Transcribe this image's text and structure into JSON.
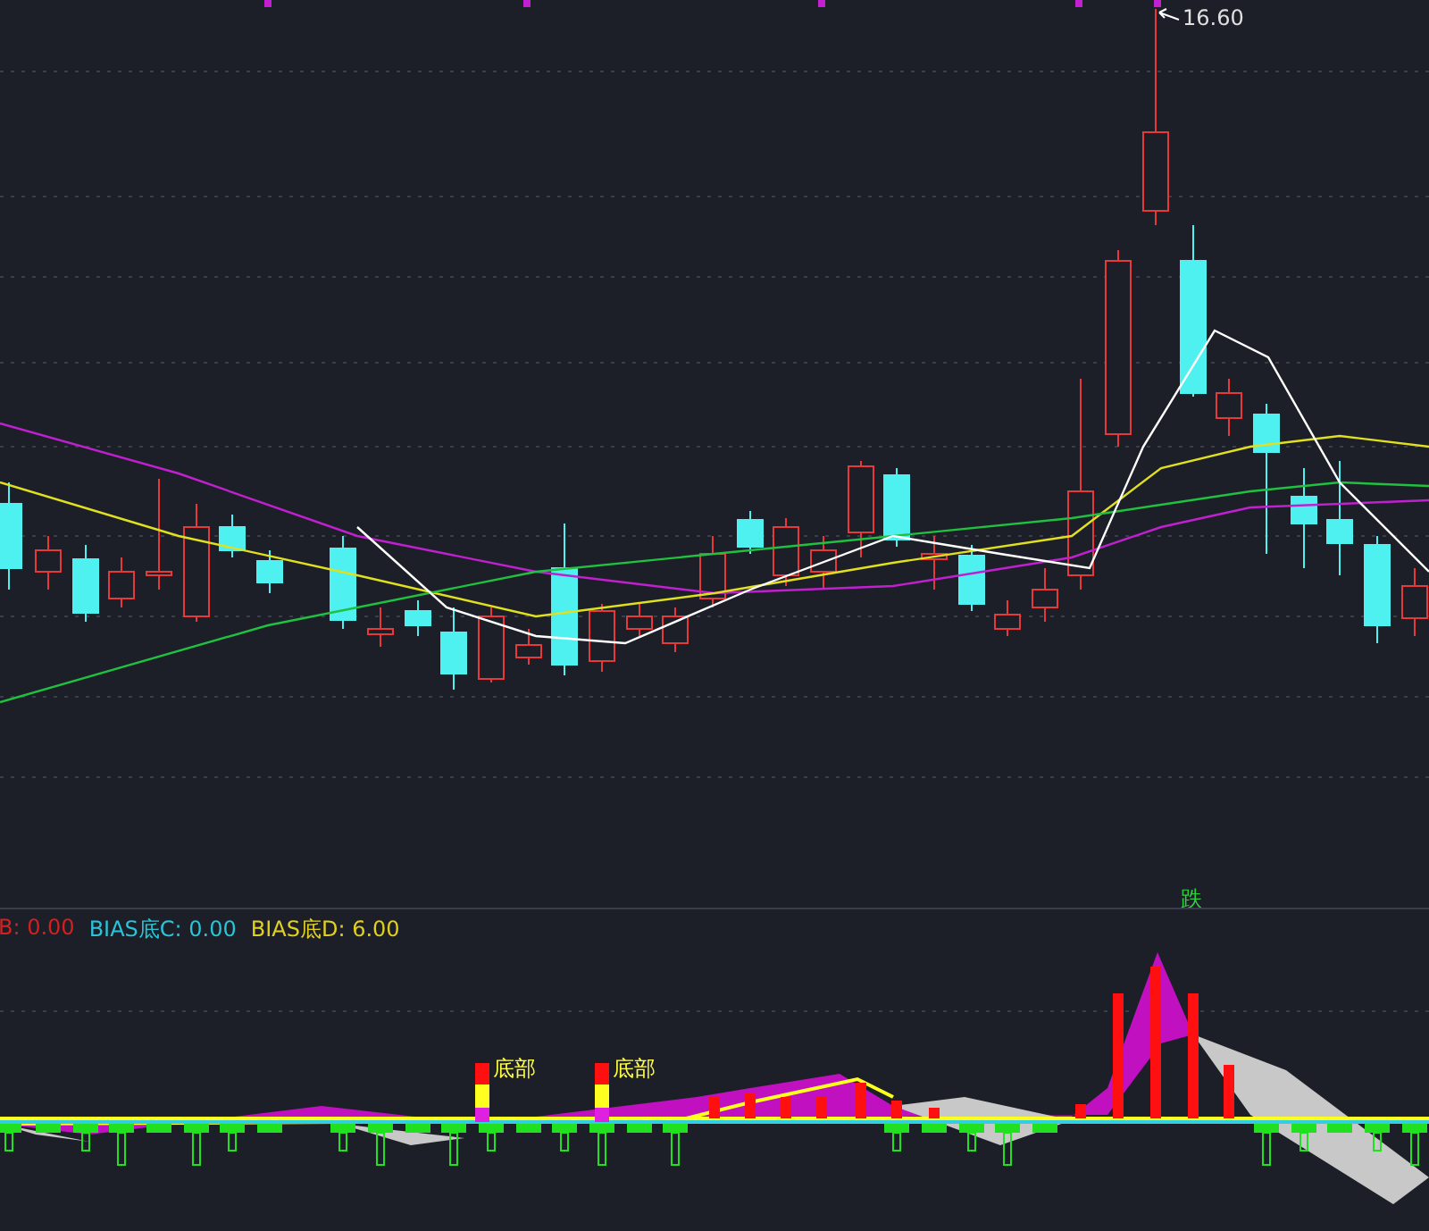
{
  "main_chart": {
    "high_label": "16.60",
    "signal_label": "跌"
  },
  "indicator": {
    "legend": [
      {
        "label": "B: 0.00",
        "color": "#d42020"
      },
      {
        "label": "BIAS底C: 0.00",
        "color": "#29c4d8"
      },
      {
        "label": "BIAS底D: 6.00",
        "color": "#e0d020"
      }
    ],
    "markers": [
      {
        "label": "底部"
      },
      {
        "label": "底部"
      }
    ]
  }
}
